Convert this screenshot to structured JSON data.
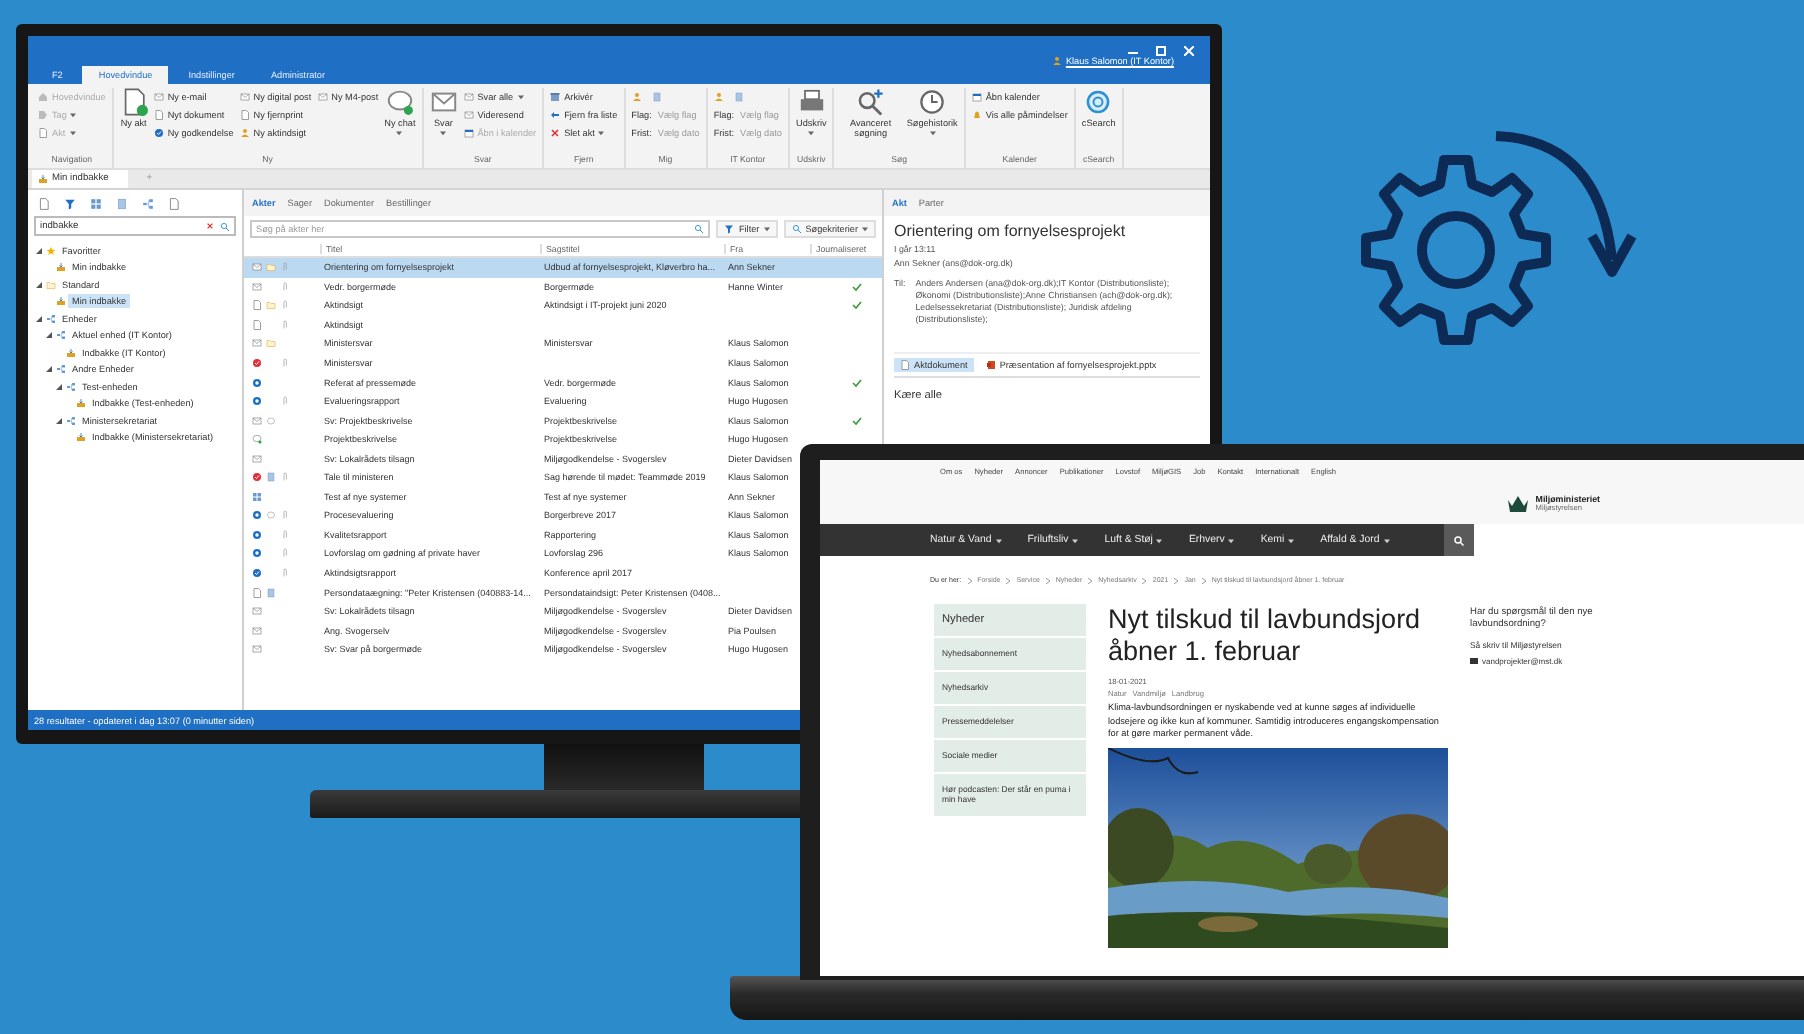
{
  "user": "Klaus Salomon (IT Kontor)",
  "ribbon_tabs": [
    {
      "label": "F2",
      "selected": false
    },
    {
      "label": "Hovedvindue",
      "selected": true
    },
    {
      "label": "Indstillinger",
      "selected": false
    },
    {
      "label": "Administrator",
      "selected": false
    }
  ],
  "ribbon_groups": [
    {
      "name": "Navigation",
      "columns": [
        {
          "kind": "small",
          "items": [
            {
              "label": "Hovedvindue",
              "kind": "home",
              "disabled": true,
              "dropdown": false
            },
            {
              "label": "Tag",
              "kind": "tag",
              "disabled": true,
              "dropdown": true
            },
            {
              "label": "Akt",
              "kind": "doc",
              "disabled": true,
              "dropdown": true
            }
          ]
        }
      ]
    },
    {
      "name": "Ny",
      "columns": [
        {
          "kind": "large",
          "button": {
            "label": "Ny akt",
            "kind": "new-doc",
            "dropdown": false
          }
        },
        {
          "kind": "small",
          "items": [
            {
              "label": "Ny e-mail",
              "kind": "mail",
              "disabled": false,
              "dropdown": false
            },
            {
              "label": "Nyt dokument",
              "kind": "doc",
              "disabled": false,
              "dropdown": false
            },
            {
              "label": "Ny godkendelse",
              "kind": "approve",
              "disabled": false,
              "dropdown": false
            }
          ]
        },
        {
          "kind": "small",
          "items": [
            {
              "label": "Ny digital post",
              "kind": "mail",
              "disabled": false,
              "dropdown": false
            },
            {
              "label": "Ny fjernprint",
              "kind": "doc",
              "disabled": false,
              "dropdown": false
            },
            {
              "label": "Ny aktindsigt",
              "kind": "person",
              "disabled": false,
              "dropdown": false
            }
          ]
        },
        {
          "kind": "small",
          "items": [
            {
              "label": "Ny M4-post",
              "kind": "mail",
              "disabled": false,
              "dropdown": false
            }
          ]
        },
        {
          "kind": "large",
          "button": {
            "label": "Ny chat",
            "kind": "chat",
            "dropdown": true
          }
        }
      ]
    },
    {
      "name": "Svar",
      "columns": [
        {
          "kind": "large",
          "button": {
            "label": "Svar",
            "kind": "mail",
            "dropdown": true
          }
        },
        {
          "kind": "small",
          "items": [
            {
              "label": "Svar alle",
              "kind": "mail",
              "disabled": false,
              "dropdown": true
            },
            {
              "label": "Videresend",
              "kind": "mail",
              "disabled": false,
              "dropdown": false
            },
            {
              "label": "Åbn i kalender",
              "kind": "calendar",
              "disabled": true,
              "dropdown": false
            }
          ]
        }
      ]
    },
    {
      "name": "Fjern",
      "columns": [
        {
          "kind": "small",
          "items": [
            {
              "label": "Arkivér",
              "kind": "archive",
              "disabled": false,
              "dropdown": false
            },
            {
              "label": "Fjern fra liste",
              "kind": "arrow",
              "disabled": false,
              "dropdown": false
            },
            {
              "label": "Slet akt",
              "kind": "delete",
              "disabled": false,
              "dropdown": true
            }
          ]
        }
      ]
    },
    {
      "name": "Mig",
      "columns": [
        {
          "kind": "fields",
          "items": [
            {
              "label": "Flag:",
              "value": "Vælg flag"
            },
            {
              "label": "Frist:",
              "value": "Vælg dato"
            }
          ]
        }
      ]
    },
    {
      "name": "IT Kontor",
      "columns": [
        {
          "kind": "fields",
          "items": [
            {
              "label": "Flag:",
              "value": "Vælg flag"
            },
            {
              "label": "Frist:",
              "value": "Vælg dato"
            }
          ]
        }
      ]
    },
    {
      "name": "Udskriv",
      "columns": [
        {
          "kind": "large",
          "button": {
            "label": "Udskriv",
            "kind": "print",
            "dropdown": true
          }
        }
      ]
    },
    {
      "name": "Søg",
      "columns": [
        {
          "kind": "large",
          "button": {
            "label": "Avanceret søgning",
            "kind": "search-plus",
            "dropdown": false
          }
        },
        {
          "kind": "large",
          "button": {
            "label": "Søgehistorik",
            "kind": "history",
            "dropdown": true
          }
        }
      ]
    },
    {
      "name": "Kalender",
      "columns": [
        {
          "kind": "small",
          "items": [
            {
              "label": "Åbn kalender",
              "kind": "calendar",
              "disabled": false,
              "dropdown": false
            },
            {
              "label": "Vis alle påmindelser",
              "kind": "bell",
              "disabled": false,
              "dropdown": false
            }
          ]
        }
      ]
    },
    {
      "name": "cSearch",
      "columns": [
        {
          "kind": "large",
          "button": {
            "label": "cSearch",
            "kind": "csearch",
            "dropdown": false
          }
        }
      ]
    }
  ],
  "document_tabs": [
    {
      "label": "Min indbakke",
      "selected": true
    },
    {
      "label": "+",
      "selected": false
    }
  ],
  "sidebar_search": {
    "value": "indbakke"
  },
  "tree": [
    {
      "label": "Favoritter",
      "kind": "star",
      "expanded": true,
      "selected": false,
      "children": [
        {
          "label": "Min indbakke",
          "kind": "inbox",
          "selected": false
        }
      ]
    },
    {
      "label": "Standard",
      "kind": "folder",
      "expanded": true,
      "selected": false,
      "children": [
        {
          "label": "Min indbakke",
          "kind": "inbox",
          "selected": true
        }
      ]
    },
    {
      "label": "Enheder",
      "kind": "unit",
      "expanded": true,
      "selected": false,
      "children": [
        {
          "label": "Aktuel enhed (IT Kontor)",
          "kind": "unit",
          "expanded": true,
          "selected": false,
          "children": [
            {
              "label": "Indbakke (IT Kontor)",
              "kind": "inbox",
              "selected": false
            }
          ]
        },
        {
          "label": "Andre Enheder",
          "kind": "unit",
          "expanded": true,
          "selected": false,
          "children": [
            {
              "label": "Test-enheden",
              "kind": "unit",
              "expanded": true,
              "selected": false,
              "children": [
                {
                  "label": "Indbakke (Test-enheden)",
                  "kind": "inbox",
                  "selected": false
                }
              ]
            },
            {
              "label": "Ministersekretariat",
              "kind": "unit",
              "expanded": true,
              "selected": false,
              "children": [
                {
                  "label": "Indbakke (Ministersekretariat)",
                  "kind": "inbox",
                  "selected": false
                }
              ]
            }
          ]
        }
      ]
    }
  ],
  "list_tabs": [
    {
      "label": "Akter",
      "selected": true
    },
    {
      "label": "Sager",
      "selected": false
    },
    {
      "label": "Dokumenter",
      "selected": false
    },
    {
      "label": "Bestillinger",
      "selected": false
    }
  ],
  "list_search": {
    "placeholder": "Søg på akter her"
  },
  "list_buttons": [
    {
      "label": "Filter",
      "kind": "filter"
    },
    {
      "label": "Søgekriterier",
      "kind": "criteria"
    }
  ],
  "columns": [
    "Titel",
    "Sagstitel",
    "Fra",
    "Journaliseret"
  ],
  "rows": [
    {
      "title": "Orientering om fornyelsesprojekt",
      "case": "Udbud af fornyelsesprojekt, Kløverbro ha...",
      "from": "Ann Sekner",
      "kind": "mail",
      "marker": {
        "kind": "folder"
      },
      "attachment": true,
      "journalized": false,
      "selected": true
    },
    {
      "title": "Vedr. borgermøde",
      "case": "Borgermøde",
      "from": "Hanne Winter",
      "kind": "mail",
      "attachment": true,
      "journalized": true,
      "selected": false
    },
    {
      "title": "Aktindsigt",
      "case": "Aktindsigt i IT-projekt juni 2020",
      "kind": "doc",
      "marker": {
        "kind": "folder"
      },
      "attachment": true,
      "journalized": true,
      "selected": false
    },
    {
      "title": "Aktindsigt",
      "kind": "doc",
      "attachment": true,
      "journalized": false,
      "selected": false
    },
    {
      "title": "Ministersvar",
      "case": "Ministersvar",
      "from": "Klaus Salomon",
      "kind": "mail",
      "marker": {
        "kind": "folder"
      },
      "attachment": false,
      "journalized": false,
      "selected": false
    },
    {
      "title": "Ministersvar",
      "from": "Klaus Salomon",
      "kind": "red",
      "attachment": true,
      "journalized": false,
      "selected": false
    },
    {
      "title": "Referat af pressemøde",
      "case": "Vedr. borgermøde",
      "from": "Klaus Salomon",
      "kind": "blue",
      "attachment": false,
      "journalized": true,
      "selected": false
    },
    {
      "title": "Evalueringsrapport",
      "case": "Evaluering",
      "from": "Hugo Hugosen",
      "kind": "blue",
      "attachment": true,
      "journalized": false,
      "selected": false
    },
    {
      "title": "Sv: Projektbeskrivelse",
      "case": "Projektbeskrivelse",
      "from": "Klaus Salomon",
      "kind": "mail",
      "marker": {
        "kind": "comment"
      },
      "attachment": false,
      "journalized": true,
      "selected": false
    },
    {
      "title": "Projektbeskrivelse",
      "case": "Projektbeskrivelse",
      "from": "Hugo Hugosen",
      "kind": "chat",
      "attachment": false,
      "journalized": false,
      "selected": false
    },
    {
      "title": "Sv: Lokalrådets tilsagn",
      "case": "Miljøgodkendelse - Svogerslev",
      "from": "Dieter Davidsen",
      "kind": "mail",
      "attachment": false,
      "journalized": false,
      "selected": false
    },
    {
      "title": "Tale til ministeren",
      "case": "Sag hørende til mødet: Teammøde 2019",
      "from": "Klaus Salomon",
      "kind": "red",
      "marker": {
        "kind": "note"
      },
      "attachment": true,
      "journalized": false,
      "selected": false
    },
    {
      "title": "Test af nye systemer",
      "case": "Test af nye systemer",
      "from": "Ann Sekner",
      "kind": "grid",
      "attachment": false,
      "journalized": false,
      "selected": false
    },
    {
      "title": "Procesevaluering",
      "case": "Borgerbreve 2017",
      "from": "Klaus Salomon",
      "kind": "blue",
      "marker": {
        "kind": "comment"
      },
      "attachment": true,
      "journalized": false,
      "selected": false
    },
    {
      "title": "Kvalitetsrapport",
      "case": "Rapportering",
      "from": "Klaus Salomon",
      "kind": "blue",
      "attachment": true,
      "journalized": false,
      "selected": false
    },
    {
      "title": "Lovforslag om gødning af private haver",
      "case": "Lovforslag 296",
      "from": "Klaus Salomon",
      "kind": "blue",
      "attachment": true,
      "journalized": false,
      "selected": false
    },
    {
      "title": "Aktindsigtsrapport",
      "case": "Konference april 2017",
      "kind": "bluecheck",
      "attachment": true,
      "journalized": false,
      "selected": false
    },
    {
      "title": "Persondataægning: \"Peter Kristensen (040883-14...",
      "case": "Persondataindsigt: Peter Kristensen (0408...",
      "kind": "doc",
      "marker": {
        "kind": "note"
      },
      "attachment": false,
      "journalized": false,
      "selected": false
    },
    {
      "title": "Sv: Lokalrådets tilsagn",
      "case": "Miljøgodkendelse - Svogerslev",
      "from": "Dieter Davidsen",
      "kind": "mail",
      "attachment": false,
      "journalized": false,
      "selected": false
    },
    {
      "title": "Ang. Svogerselv",
      "case": "Miljøgodkendelse - Svogerslev",
      "from": "Pia Poulsen",
      "kind": "mail",
      "attachment": false,
      "journalized": false,
      "selected": false
    },
    {
      "title": "Sv: Svar på borgermøde",
      "case": "Miljøgodkendelse - Svogerslev",
      "from": "Hugo Hugosen",
      "kind": "mail",
      "attachment": false,
      "journalized": false,
      "selected": false
    }
  ],
  "status_bar": "28 resultater - opdateret i dag 13:07 (0 minutter siden)",
  "preview": {
    "tabs": [
      {
        "label": "Akt",
        "selected": true
      },
      {
        "label": "Parter",
        "selected": false
      }
    ],
    "subject": "Orientering om fornyelsesprojekt",
    "date": "I går 13:11",
    "sender": "Ann Sekner (ans@dok-org.dk)",
    "to_label": "Til:",
    "recipients": "Anders Andersen (ana@dok-org.dk);IT Kontor (Distributionsliste); Økonomi (Distributionsliste);Anne Christiansen (ach@dok-org.dk); Ledelsessekretariat (Distributionsliste); Juridisk afdeling (Distributionsliste);",
    "attachments": [
      {
        "name": "Aktdokument",
        "kind": "doc",
        "selected": true
      },
      {
        "name": "Præsentation af fornyelsesprojekt.pptx",
        "kind": "pptx",
        "selected": false
      }
    ],
    "greeting": "Kære alle"
  },
  "website": {
    "top_links": [
      "Om os",
      "Nyheder",
      "Annoncer",
      "Publikationer",
      "Lovstof",
      "MiljøGIS",
      "Job",
      "Kontakt",
      "Internationalt",
      "English"
    ],
    "logo": {
      "name": "Miljøministeriet",
      "sub": "Miljøstyrelsen"
    },
    "nav": [
      "Natur & Vand",
      "Friluftsliv",
      "Luft & Støj",
      "Erhverv",
      "Kemi",
      "Affald & Jord"
    ],
    "breadcrumb": [
      "Du er her:",
      "Forside",
      "Service",
      "Nyheder",
      "Nyhedsarkiv",
      "2021",
      "Jan",
      "Nyt tilskud til lavbundsjord åbner 1. februar"
    ],
    "menu_title": "Nyheder",
    "menu": [
      "Nyhedsabonnement",
      "Nyhedsarkiv",
      "Pressemeddelelser",
      "Sociale medier",
      "Hør podcasten: Der står en puma i min have"
    ],
    "title": "Nyt tilskud til lavbundsjord åbner 1. februar",
    "date": "18-01-2021",
    "tags": [
      "Natur",
      "Vandmiljø",
      "Landbrug"
    ],
    "lead": "Klima-lavbundsordningen er nyskabende ved at kunne søges af individuelle lodsejere og ikke kun af kommuner. Samtidig introduceres engangskompensation for at gøre marker permanent våde.",
    "aside": {
      "question": "Har du spørgsmål til den nye lavbundsordning?",
      "prompt": "Så skriv til Miljøstyrelsen",
      "email": "vandprojekter@mst.dk"
    }
  }
}
